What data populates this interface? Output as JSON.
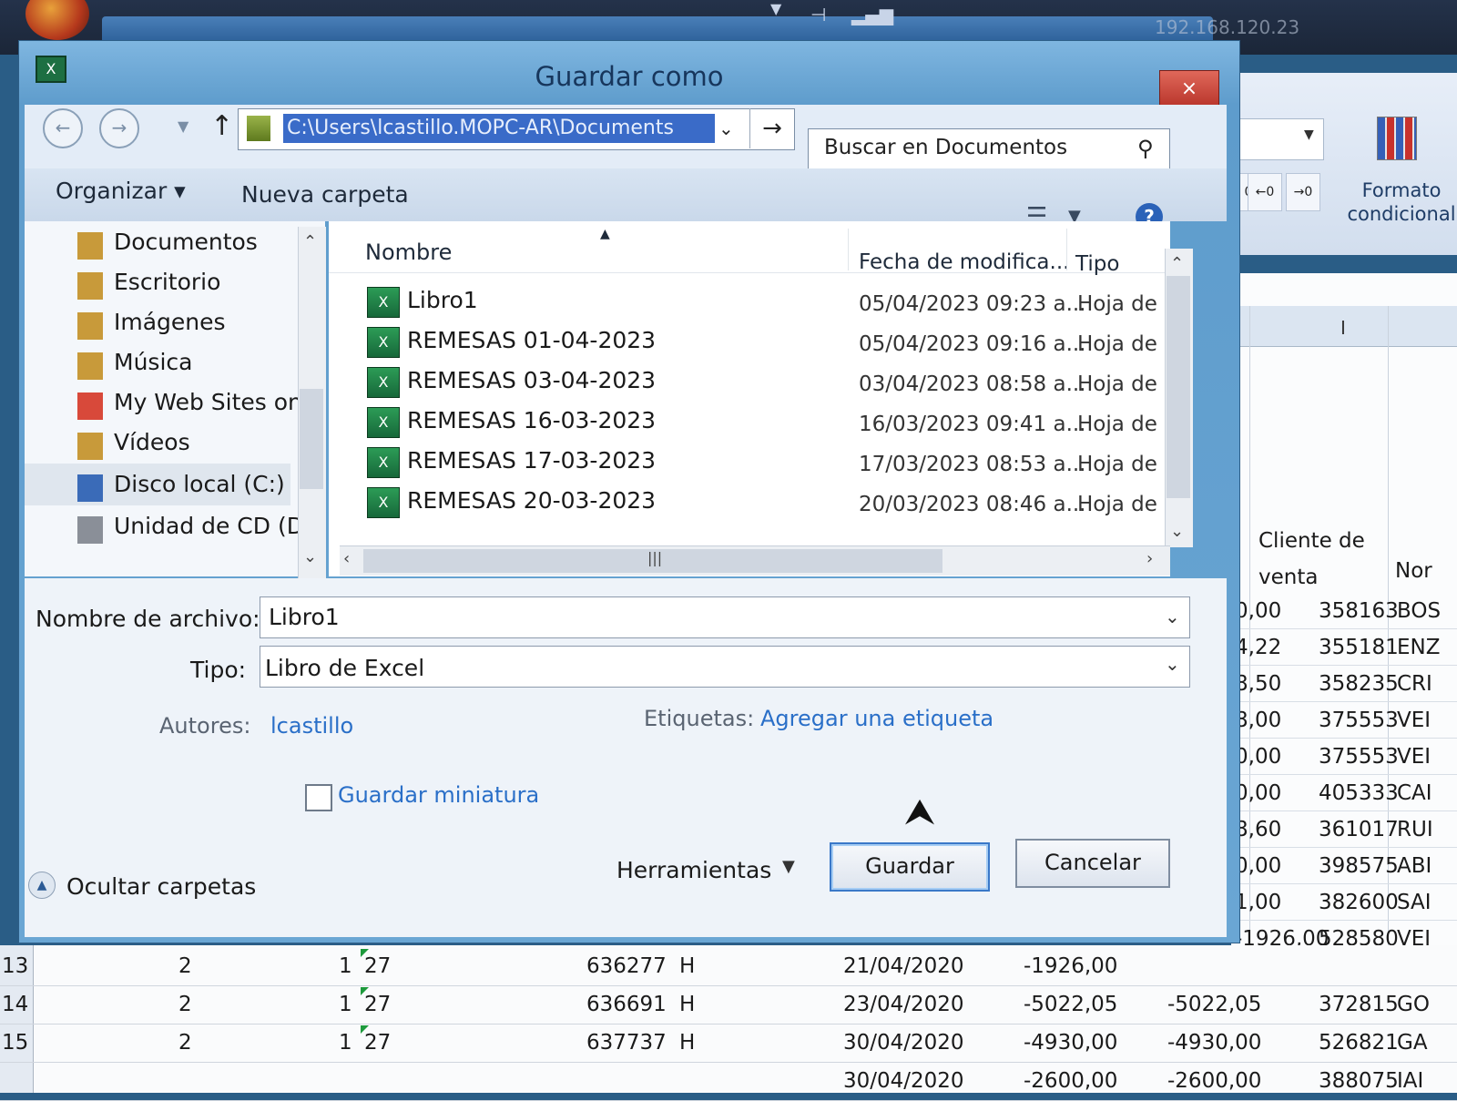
{
  "dialog": {
    "title": "Guardar como",
    "close_glyph": "×"
  },
  "taskbar": {
    "ip": "192.168.120.23"
  },
  "nav": {
    "address_path": "C:\\Users\\lcastillo.MOPC-AR\\Documents",
    "search_placeholder": "Buscar en Documentos"
  },
  "toolbar": {
    "organize_label": "Organizar ▾",
    "new_folder_label": "Nueva carpeta"
  },
  "sidebar": {
    "items": [
      {
        "label": "Documentos",
        "icon": "documents-folder-icon"
      },
      {
        "label": "Escritorio",
        "icon": "desktop-folder-icon"
      },
      {
        "label": "Imágenes",
        "icon": "pictures-folder-icon"
      },
      {
        "label": "Música",
        "icon": "music-folder-icon"
      },
      {
        "label": "My Web Sites on",
        "icon": "web-sites-icon"
      },
      {
        "label": "Vídeos",
        "icon": "videos-folder-icon"
      },
      {
        "label": "Disco local (C:)",
        "icon": "local-disk-icon"
      },
      {
        "label": "Unidad de CD (D:",
        "icon": "cd-drive-icon"
      }
    ]
  },
  "file_list": {
    "columns": [
      "Nombre",
      "Fecha de modifica...",
      "Tipo"
    ],
    "rows": [
      {
        "name": "Libro1",
        "date": "05/04/2023 09:23 a...",
        "type": "Hoja de c"
      },
      {
        "name": "REMESAS 01-04-2023",
        "date": "05/04/2023 09:16 a...",
        "type": "Hoja de c"
      },
      {
        "name": "REMESAS 03-04-2023",
        "date": "03/04/2023 08:58 a...",
        "type": "Hoja de c"
      },
      {
        "name": "REMESAS 16-03-2023",
        "date": "16/03/2023 09:41 a...",
        "type": "Hoja de c"
      },
      {
        "name": "REMESAS 17-03-2023",
        "date": "17/03/2023 08:53 a...",
        "type": "Hoja de c"
      },
      {
        "name": "REMESAS 20-03-2023",
        "date": "20/03/2023 08:46 a...",
        "type": "Hoja de c"
      }
    ]
  },
  "form": {
    "filename_label": "Nombre de archivo:",
    "filename_value": "Libro1",
    "type_label": "Tipo:",
    "type_value": "Libro de Excel",
    "authors_label": "Autores:",
    "authors_value": "lcastillo",
    "tags_label": "Etiquetas:",
    "tags_link": "Agregar una etiqueta",
    "thumbnail_label": "Guardar miniatura",
    "hide_folders_label": "Ocultar carpetas",
    "tools_label": "Herramientas",
    "save_label": "Guardar",
    "cancel_label": "Cancelar"
  },
  "ribbon": {
    "format_label": "Formato condicional"
  },
  "sheet": {
    "column_header": "I",
    "client_header": "Cliente de venta",
    "name_header": "Nor",
    "right_rows": [
      {
        "amount": "0,00",
        "client": "358163",
        "name": "BOS"
      },
      {
        "amount": "4,22",
        "client": "355181",
        "name": "ENZ"
      },
      {
        "amount": "8,50",
        "client": "358235",
        "name": "CRI"
      },
      {
        "amount": "8,00",
        "client": "375553",
        "name": "VEI"
      },
      {
        "amount": "0,00",
        "client": "375553",
        "name": "VEI"
      },
      {
        "amount": "0,00",
        "client": "405333",
        "name": "CAI"
      },
      {
        "amount": "8,60",
        "client": "361017",
        "name": "RUI"
      },
      {
        "amount": "0,00",
        "client": "398575",
        "name": "ABI"
      },
      {
        "amount": "1,00",
        "client": "382600",
        "name": "SAI"
      },
      {
        "amount": "-1926,00",
        "client": "528580",
        "name": "VEI"
      }
    ],
    "bottom_rows": [
      {
        "row": "13",
        "c1": "2",
        "c2": "1",
        "c3": "27",
        "doc": "636277",
        "h": "H",
        "date": "21/04/2020",
        "v1": "-1926,00"
      },
      {
        "row": "14",
        "c1": "2",
        "c2": "1",
        "c3": "27",
        "doc": "636691",
        "h": "H",
        "date": "23/04/2020",
        "v1": "-5022,05",
        "v2": "-5022,05",
        "client": "372815",
        "name": "GO"
      },
      {
        "row": "15",
        "c1": "2",
        "c2": "1",
        "c3": "27",
        "doc": "637737",
        "h": "H",
        "date": "30/04/2020",
        "v1": "-4930,00",
        "v2": "-4930,00",
        "client": "526821",
        "name": "GA"
      },
      {
        "date": "30/04/2020",
        "v1": "-2600,00",
        "v2": "-2600,00",
        "client": "388075",
        "name": "IAI"
      }
    ]
  }
}
